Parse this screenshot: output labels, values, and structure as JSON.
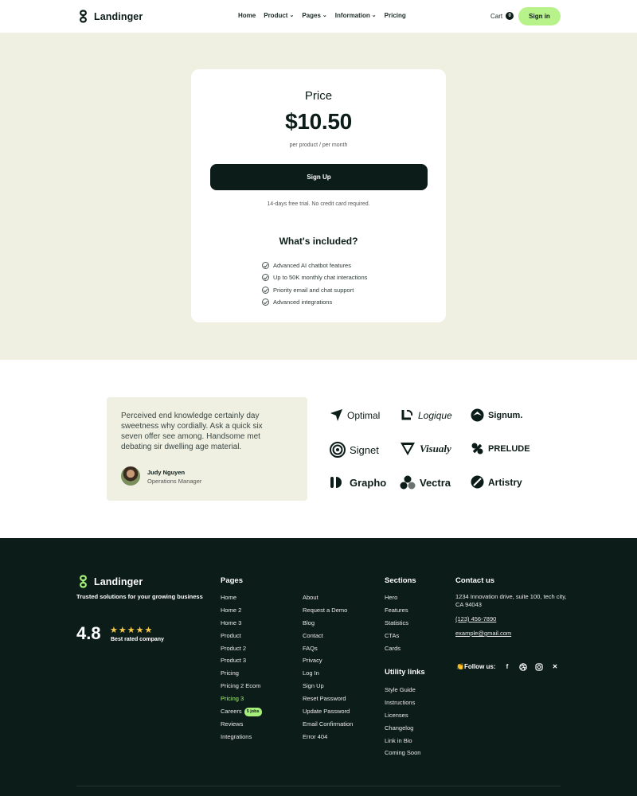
{
  "brand": {
    "name": "Landinger"
  },
  "nav": {
    "links": [
      {
        "label": "Home"
      },
      {
        "label": "Product"
      },
      {
        "label": "Pages"
      },
      {
        "label": "Information"
      },
      {
        "label": "Pricing"
      }
    ],
    "cart_label": "Cart",
    "cart_count": "0",
    "signin_label": "Sign in"
  },
  "pricing": {
    "title": "Price",
    "price": "$10.50",
    "period": "per product / per month",
    "cta": "Sign Up",
    "trial_note": "14-days free trial. No credit card required.",
    "included_title": "What's included?",
    "features": [
      "Advanced AI chatbot features",
      "Up to 50K monthly chat interactions",
      "Priority email and chat support",
      "Advanced integrations"
    ]
  },
  "testimonial": {
    "quote": "Perceived end knowledge certainly day sweetness why cordially. Ask a quick six seven offer see among. Handsome met debating sir dwelling age material.",
    "name": "Judy Nguyen",
    "role": "Operations Manager"
  },
  "logos": [
    "Optimal",
    "Logique",
    "Signum.",
    "Signet",
    "Visualy",
    "PRELUDE",
    "Grapho",
    "Vectra",
    "Artistry"
  ],
  "footer": {
    "tagline": "Trusted solutions for your growing business",
    "rating": "4.8",
    "stars": "★★★★★",
    "rating_label": "Best rated company",
    "pages_title": "Pages",
    "pages_col1": [
      "Home",
      "Home 2",
      "Home 3",
      "Product",
      "Product 2",
      "Product 3",
      "Pricing",
      "Pricing 2 Ecom",
      "Pricing 3",
      "Careers",
      "Reviews",
      "Integrations"
    ],
    "careers_badge": "5 jobs",
    "pages_col2": [
      "About",
      "Request a Demo",
      "Blog",
      "Contact",
      "FAQs",
      "Privacy",
      "Log In",
      "Sign Up",
      "Reset Password",
      "Update Password",
      "Email Confirmation",
      "Error 404"
    ],
    "sections_title": "Sections",
    "sections": [
      "Hero",
      "Features",
      "Statistics",
      "CTAs",
      "Cards"
    ],
    "utility_title": "Utility links",
    "utility": [
      "Style Guide",
      "Instructions",
      "Licenses",
      "Changelog",
      "Link in Bio",
      "Coming Soon"
    ],
    "contact_title": "Contact us",
    "address": "1234 Innovation drive, suite 100, tech city, CA 94043",
    "phone": "(123) 456-7890",
    "email": "example@gmail.com",
    "follow_label": "👏Follow us:",
    "socials": [
      "facebook-icon",
      "dribbble-icon",
      "instagram-icon",
      "x-icon"
    ]
  }
}
